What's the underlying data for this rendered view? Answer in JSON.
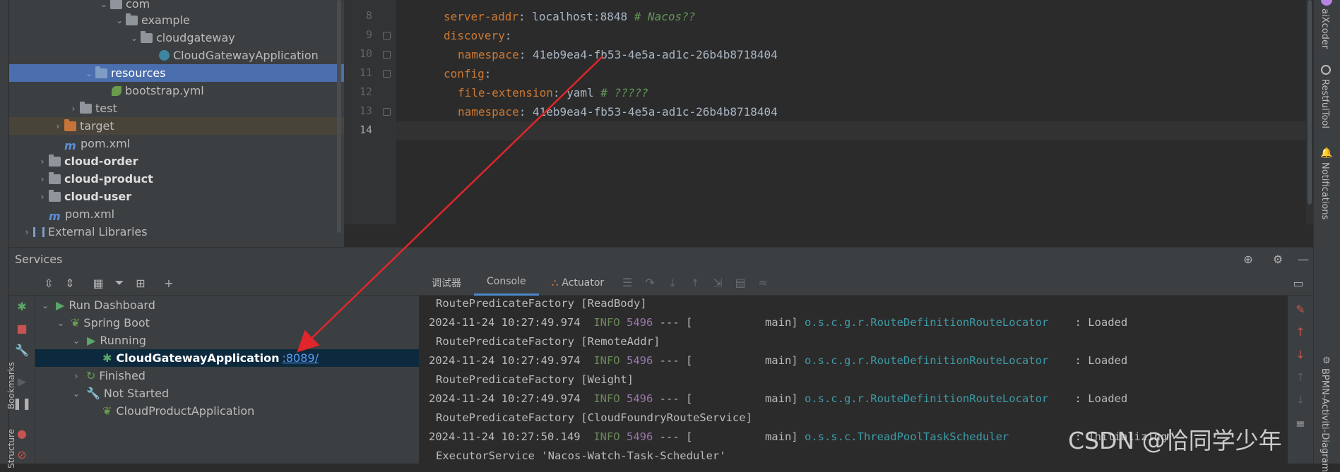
{
  "project_tree": {
    "items": [
      {
        "label": "com",
        "kind": "package",
        "expanded": true
      },
      {
        "label": "example",
        "kind": "package",
        "expanded": true
      },
      {
        "label": "cloudgateway",
        "kind": "package",
        "expanded": true
      },
      {
        "label": "CloudGatewayApplication",
        "kind": "spring-class"
      },
      {
        "label": "resources",
        "kind": "resources-folder",
        "expanded": true,
        "selected": true
      },
      {
        "label": "bootstrap.yml",
        "kind": "yaml-file"
      },
      {
        "label": "test",
        "kind": "folder",
        "expanded": false
      },
      {
        "label": "target",
        "kind": "excluded-folder",
        "expanded": false
      },
      {
        "label": "pom.xml",
        "kind": "maven-file"
      },
      {
        "label": "cloud-order",
        "kind": "module",
        "expanded": false
      },
      {
        "label": "cloud-product",
        "kind": "module",
        "expanded": false
      },
      {
        "label": "cloud-user",
        "kind": "module",
        "expanded": false
      },
      {
        "label": "pom.xml",
        "kind": "maven-file"
      },
      {
        "label": "External Libraries",
        "kind": "libraries",
        "expanded": false
      }
    ]
  },
  "editor": {
    "lines": [
      {
        "num": "8",
        "key": "server-addr",
        "value": "localhost:8848",
        "comment": "# Nacos??",
        "indent": "  "
      },
      {
        "num": "9",
        "key": "discovery",
        "value": "",
        "comment": "",
        "indent": "  "
      },
      {
        "num": "10",
        "key": "namespace",
        "value": "41eb9ea4-fb53-4e5a-ad1c-26b4b8718404",
        "comment": "",
        "indent": "    "
      },
      {
        "num": "11",
        "key": "config",
        "value": "",
        "comment": "",
        "indent": "  "
      },
      {
        "num": "12",
        "key": "file-extension",
        "value": "yaml",
        "comment": "# ?????",
        "indent": "    "
      },
      {
        "num": "13",
        "key": "namespace",
        "value": "41eb9ea4-fb53-4e5a-ad1c-26b4b8718404",
        "comment": "",
        "indent": "    "
      },
      {
        "num": "14",
        "key": "",
        "value": "",
        "comment": "",
        "indent": ""
      }
    ]
  },
  "right_tool_windows": [
    "aiXcoder",
    "RestfulTool",
    "Notifications",
    "BPMN-Activiti-Diagram"
  ],
  "left_tool_windows": [
    "Bookmarks",
    "Structure"
  ],
  "services": {
    "title": "Services",
    "tree": [
      {
        "label": "Run Dashboard",
        "level": 0
      },
      {
        "label": "Spring Boot",
        "level": 1
      },
      {
        "label": "Running",
        "level": 2
      },
      {
        "label": "CloudGatewayApplication",
        "port": ":8089/",
        "level": 3,
        "selected": true
      },
      {
        "label": "Finished",
        "level": 2
      },
      {
        "label": "Not Started",
        "level": 2
      },
      {
        "label": "CloudProductApplication",
        "level": 3
      }
    ]
  },
  "console": {
    "tabs": [
      "调试器",
      "Console",
      "Actuator"
    ],
    "active_tab": "Console",
    "lines": [
      {
        "type": "cont",
        "text": "RoutePredicateFactory [ReadBody]"
      },
      {
        "type": "log",
        "ts": "2024-11-24 10:27:49.974",
        "level": "INFO",
        "pid": "5496",
        "mid": " --- [           main] ",
        "logger": "o.s.c.g.r.RouteDefinitionRouteLocator",
        "msg": "    : Loaded"
      },
      {
        "type": "cont",
        "text": "RoutePredicateFactory [RemoteAddr]"
      },
      {
        "type": "log",
        "ts": "2024-11-24 10:27:49.974",
        "level": "INFO",
        "pid": "5496",
        "mid": " --- [           main] ",
        "logger": "o.s.c.g.r.RouteDefinitionRouteLocator",
        "msg": "    : Loaded"
      },
      {
        "type": "cont",
        "text": "RoutePredicateFactory [Weight]"
      },
      {
        "type": "log",
        "ts": "2024-11-24 10:27:49.974",
        "level": "INFO",
        "pid": "5496",
        "mid": " --- [           main] ",
        "logger": "o.s.c.g.r.RouteDefinitionRouteLocator",
        "msg": "    : Loaded"
      },
      {
        "type": "cont",
        "text": "RoutePredicateFactory [CloudFoundryRouteService]"
      },
      {
        "type": "log",
        "ts": "2024-11-24 10:27:50.149",
        "level": "INFO",
        "pid": "5496",
        "mid": " --- [           main] ",
        "logger": "o.s.s.c.ThreadPoolTaskScheduler",
        "msg": "          : Initializing"
      },
      {
        "type": "cont",
        "text": "ExecutorService 'Nacos-Watch-Task-Scheduler'"
      }
    ]
  },
  "watermark": "CSDN @恰同学少年",
  "colors": {
    "selection": "#4b6eaf",
    "annotation_arrow": "#e0262b",
    "yaml_key": "#cc7832",
    "log_info": "#6a8759",
    "log_pid": "#9876aa",
    "logger": "#3d9ca8"
  }
}
